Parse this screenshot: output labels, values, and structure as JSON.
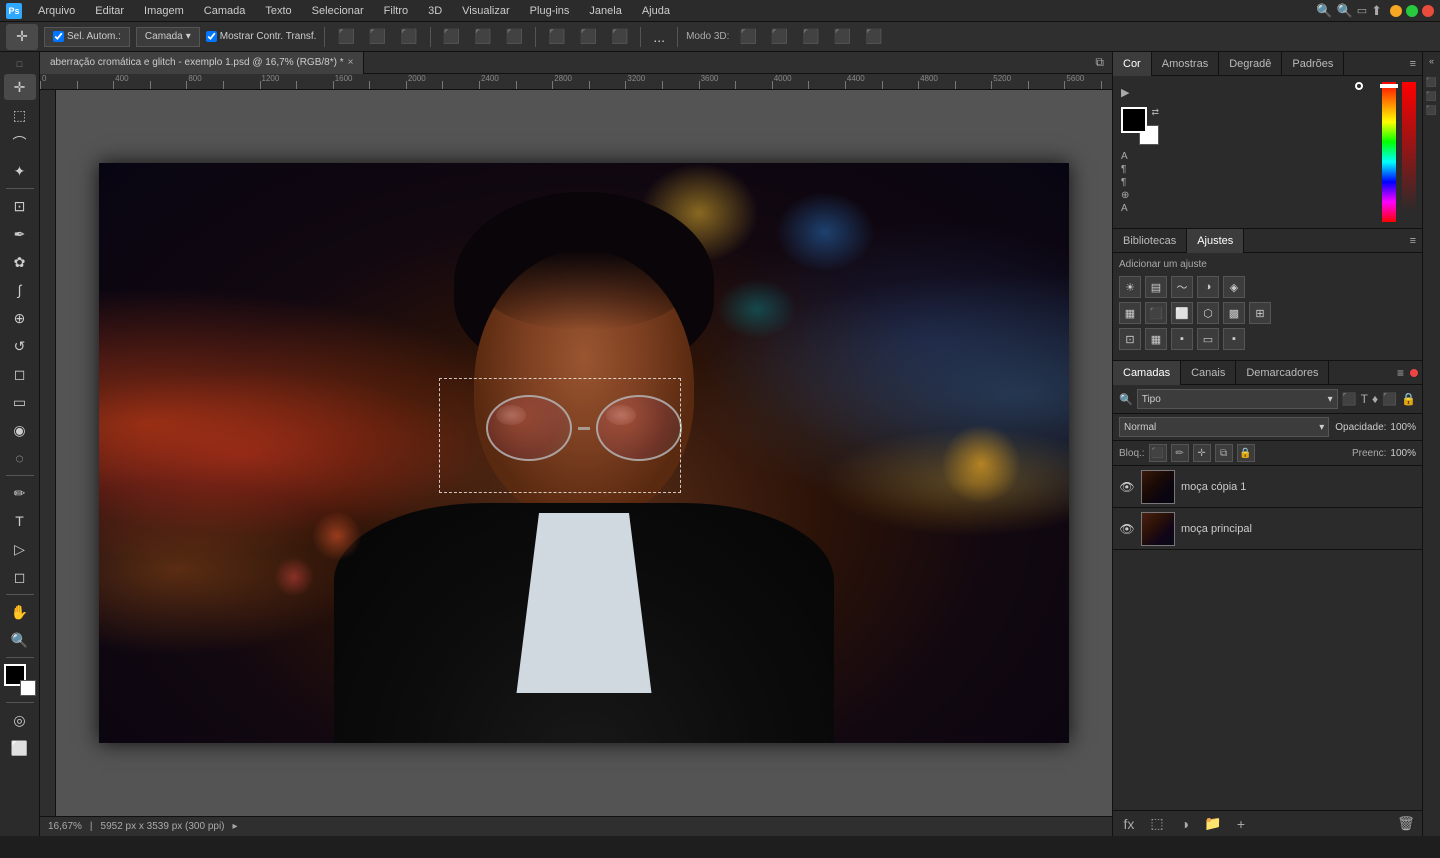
{
  "app": {
    "title": "Adobe Photoshop",
    "icon_label": "Ps"
  },
  "menu": {
    "items": [
      "Arquivo",
      "Editar",
      "Imagem",
      "Camada",
      "Texto",
      "Selecionar",
      "Filtro",
      "3D",
      "Visualizar",
      "Plug-ins",
      "Janela",
      "Ajuda"
    ]
  },
  "options_bar": {
    "tool_label": "Sel. Autom.:",
    "dropdown_label": "Camada",
    "checkbox_label": "Mostrar Contr. Transf.",
    "mode_3d_label": "Modo 3D:",
    "more_options": "..."
  },
  "tab": {
    "title": "aberração cromática e glitch - exemplo 1.psd @ 16,7% (RGB/8*) *",
    "close": "×"
  },
  "canvas": {
    "zoom": "16,67%",
    "dimensions": "5952 px x 3539 px (300 ppi)"
  },
  "right_panel": {
    "color_tabs": [
      "Cor",
      "Amostras",
      "Degradê",
      "Padrões"
    ],
    "active_color_tab": "Cor",
    "adjustment_tabs": [
      "Bibliotecas",
      "Ajustes"
    ],
    "active_adjustment_tab": "Ajustes",
    "adjustment_header": "Adicionar um ajuste",
    "layers_tabs": [
      "Camadas",
      "Canais",
      "Demarcadores"
    ],
    "active_layers_tab": "Camadas",
    "blend_mode": "Normal",
    "opacity_label": "Opacidade:",
    "opacity_value": "100%",
    "fill_label": "Preenc:",
    "fill_value": "100%",
    "lock_label": "Bloq.:",
    "filter_label": "Tipo",
    "layers": [
      {
        "name": "moça cópia 1",
        "visible": true,
        "selected": false
      },
      {
        "name": "moça principal",
        "visible": true,
        "selected": false
      }
    ]
  },
  "toolbar_tools": [
    "move",
    "marquee",
    "lasso",
    "magic-wand",
    "crop",
    "eyedropper",
    "healing",
    "brush",
    "clone",
    "history",
    "eraser",
    "gradient",
    "blur",
    "dodge",
    "pen",
    "text",
    "path-select",
    "shape",
    "hand",
    "zoom"
  ],
  "status": {
    "zoom": "16,67%",
    "dimensions": "5952 px x 3539 px (300 ppi)"
  }
}
